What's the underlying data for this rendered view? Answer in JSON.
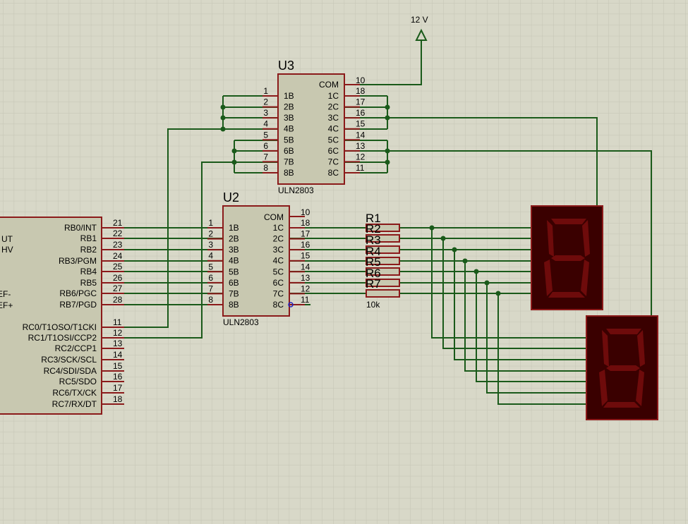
{
  "power": {
    "label": "12 V"
  },
  "u3": {
    "ref": "U3",
    "part": "ULN2803",
    "com_label": "COM",
    "com_pin": "10",
    "left_pins": [
      {
        "num": "1",
        "name": "1B"
      },
      {
        "num": "2",
        "name": "2B"
      },
      {
        "num": "3",
        "name": "3B"
      },
      {
        "num": "4",
        "name": "4B"
      },
      {
        "num": "5",
        "name": "5B"
      },
      {
        "num": "6",
        "name": "6B"
      },
      {
        "num": "7",
        "name": "7B"
      },
      {
        "num": "8",
        "name": "8B"
      }
    ],
    "right_pins": [
      {
        "num": "18",
        "name": "1C"
      },
      {
        "num": "17",
        "name": "2C"
      },
      {
        "num": "16",
        "name": "3C"
      },
      {
        "num": "15",
        "name": "4C"
      },
      {
        "num": "14",
        "name": "5C"
      },
      {
        "num": "13",
        "name": "6C"
      },
      {
        "num": "12",
        "name": "7C"
      },
      {
        "num": "11",
        "name": "8C"
      }
    ]
  },
  "u2": {
    "ref": "U2",
    "part": "ULN2803",
    "com_label": "COM",
    "com_pin": "10",
    "left_pins": [
      {
        "num": "1",
        "name": "1B"
      },
      {
        "num": "2",
        "name": "2B"
      },
      {
        "num": "3",
        "name": "3B"
      },
      {
        "num": "4",
        "name": "4B"
      },
      {
        "num": "5",
        "name": "5B"
      },
      {
        "num": "6",
        "name": "6B"
      },
      {
        "num": "7",
        "name": "7B"
      },
      {
        "num": "8",
        "name": "8B"
      }
    ],
    "right_pins": [
      {
        "num": "18",
        "name": "1C"
      },
      {
        "num": "17",
        "name": "2C"
      },
      {
        "num": "16",
        "name": "3C"
      },
      {
        "num": "15",
        "name": "4C"
      },
      {
        "num": "14",
        "name": "5C"
      },
      {
        "num": "13",
        "name": "6C"
      },
      {
        "num": "12",
        "name": "7C"
      },
      {
        "num": "11",
        "name": "8C"
      }
    ]
  },
  "mcu": {
    "left_labels": [
      "UT",
      "HV",
      "EF-",
      "EF+"
    ],
    "pins": [
      {
        "name": "RB0/INT",
        "num": "21"
      },
      {
        "name": "RB1",
        "num": "22"
      },
      {
        "name": "RB2",
        "num": "23"
      },
      {
        "name": "RB3/PGM",
        "num": "24"
      },
      {
        "name": "RB4",
        "num": "25"
      },
      {
        "name": "RB5",
        "num": "26"
      },
      {
        "name": "RB6/PGC",
        "num": "27"
      },
      {
        "name": "RB7/PGD",
        "num": "28"
      },
      {
        "name": "RC0/T1OSO/T1CKI",
        "num": "11"
      },
      {
        "name": "RC1/T1OSI/CCP2",
        "num": "12"
      },
      {
        "name": "RC2/CCP1",
        "num": "13"
      },
      {
        "name": "RC3/SCK/SCL",
        "num": "14"
      },
      {
        "name": "RC4/SDI/SDA",
        "num": "15"
      },
      {
        "name": "RC5/SDO",
        "num": "16"
      },
      {
        "name": "RC6/TX/CK",
        "num": "17"
      },
      {
        "name": "RC7/RX/DT",
        "num": "18"
      }
    ]
  },
  "resistors": {
    "refs": [
      "R1",
      "R2",
      "R3",
      "R4",
      "R5",
      "R6",
      "R7"
    ],
    "value": "10k"
  },
  "colors": {
    "background": "#d8d8c8",
    "grid": "#c4c4b4",
    "wire": "#1a5a1a",
    "body_fill": "#c8c8b0",
    "body_stroke": "#8b1a1a",
    "display_bg": "#3a0000",
    "segment": "#6e0b0b"
  }
}
